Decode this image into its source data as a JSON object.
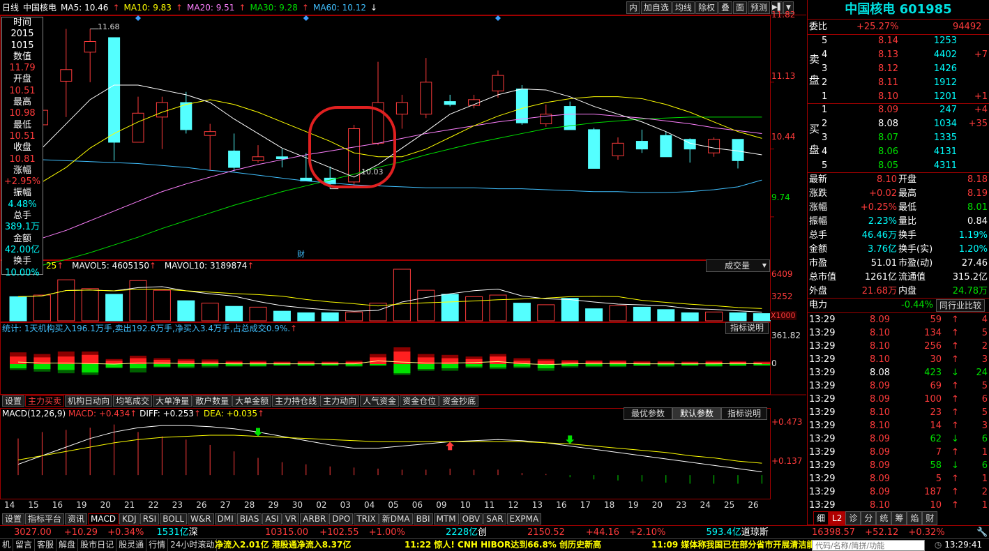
{
  "header": {
    "period": "日线",
    "stock": "中国核电",
    "ma5": "MA5: 10.46",
    "ma10": "MA10: 9.83",
    "ma20": "MA20: 9.51",
    "ma30": "MA30: 9.28",
    "ma60": "MA60: 10.12",
    "tools": [
      "内",
      "加自选",
      "均线",
      "除权",
      "叠",
      "面",
      "预测"
    ],
    "colors": {
      "ma5": "#ffffff",
      "ma10": "#ffff00",
      "ma20": "#ff80ff",
      "ma30": "#00e000",
      "ma60": "#40c0ff",
      "bull": "#ff3b3b",
      "bear": "#54ffff"
    }
  },
  "info": {
    "time_label": "时间",
    "year": "2015",
    "date": "1015",
    "value_label": "数值",
    "value": "11.79",
    "open_label": "开盘",
    "open": "10.51",
    "high_label": "最高",
    "high": "10.98",
    "low_label": "最低",
    "low": "10.51",
    "close_label": "收盘",
    "close": "10.81",
    "chg_label": "涨幅",
    "chg": "+2.95%",
    "amp_label": "振幅",
    "amp": "4.48%",
    "vol_label": "总手",
    "vol": "389.1万",
    "amt_label": "金额",
    "amt": "42.00亿",
    "turn_label": "换手",
    "turn": "10.00%"
  },
  "price_axis": [
    "11.82",
    "11.13",
    "10.44",
    "9.74"
  ],
  "price_annotations": {
    "high": "11.68",
    "low": "10.03",
    "event": "财"
  },
  "volume": {
    "header_prefix": "25",
    "mavol5": "MAVOL5: 4605150",
    "mavol10": "MAVOL10: 3189874",
    "dropdown": "成交量",
    "axis": [
      "6409",
      "3252",
      "X1000"
    ]
  },
  "flow": {
    "stats": "统计: 1天机构买入196.1万手,卖出192.6万手,净买入3.4万手,占总成交0.9%.",
    "button": "指标说明",
    "axis": [
      "361.82",
      "0"
    ],
    "tabs": [
      "设置",
      "主力买卖",
      "机构日动向",
      "均笔成交",
      "大单净量",
      "散户数量",
      "大单金额",
      "主力持仓线",
      "主力动向",
      "人气资金",
      "资金仓位",
      "资金抄底"
    ]
  },
  "macd": {
    "title": "MACD(12,26,9)",
    "macd": "MACD: +0.434",
    "diff": "DIFF: +0.253",
    "dea": "DEA: +0.035",
    "buttons": [
      "最优参数",
      "默认参数",
      "指标说明"
    ],
    "axis": [
      "+0.473",
      "+0.137"
    ]
  },
  "dates": [
    "14",
    "15",
    "16",
    "19",
    "20",
    "21",
    "22",
    "23",
    "26",
    "27",
    "28",
    "29",
    "30",
    "02",
    "03",
    "04",
    "05",
    "06",
    "09",
    "10",
    "11",
    "12",
    "13",
    "16",
    "17",
    "18",
    "19",
    "20",
    "23",
    "24",
    "25",
    "26"
  ],
  "indicator_tabs": [
    "设置",
    "指标平台",
    "资讯",
    "MACD",
    "KDJ",
    "RSI",
    "BOLL",
    "W&R",
    "DMI",
    "BIAS",
    "ASI",
    "VR",
    "ARBR",
    "DPO",
    "TRIX",
    "新DMA",
    "BBI",
    "MTM",
    "OBV",
    "SAR",
    "EXPMA"
  ],
  "quote": {
    "name": "中国核电",
    "code": "601985",
    "wb_label": "委比",
    "wb": "+25.27%",
    "wc": "94492",
    "sell_label": "卖盘",
    "buy_label": "买盘",
    "sell": [
      {
        "n": "5",
        "p": "8.14",
        "v": "1253",
        "d": ""
      },
      {
        "n": "4",
        "p": "8.13",
        "v": "4402",
        "d": "+7"
      },
      {
        "n": "3",
        "p": "8.12",
        "v": "1426",
        "d": ""
      },
      {
        "n": "2",
        "p": "8.11",
        "v": "1912",
        "d": ""
      },
      {
        "n": "1",
        "p": "8.10",
        "v": "1201",
        "d": "+1"
      }
    ],
    "buy": [
      {
        "n": "1",
        "p": "8.09",
        "v": "247",
        "d": "+4"
      },
      {
        "n": "2",
        "p": "8.08",
        "v": "1034",
        "d": "+35"
      },
      {
        "n": "3",
        "p": "8.07",
        "v": "1335",
        "d": ""
      },
      {
        "n": "4",
        "p": "8.06",
        "v": "4131",
        "d": ""
      },
      {
        "n": "5",
        "p": "8.05",
        "v": "4311",
        "d": ""
      }
    ],
    "stats": [
      {
        "l1": "最新",
        "v1": "8.10",
        "l2": "开盘",
        "v2": "8.18"
      },
      {
        "l1": "涨跌",
        "v1": "+0.02",
        "l2": "最高",
        "v2": "8.19"
      },
      {
        "l1": "涨幅",
        "v1": "+0.25%",
        "l2": "最低",
        "v2": "8.01"
      },
      {
        "l1": "振幅",
        "v1": "2.23%",
        "l2": "量比",
        "v2": "0.84"
      },
      {
        "l1": "总手",
        "v1": "46.46万",
        "l2": "换手",
        "v2": "1.19%"
      },
      {
        "l1": "金额",
        "v1": "3.76亿",
        "l2": "换手(实)",
        "v2": "1.20%"
      },
      {
        "l1": "市盈",
        "v1": "51.01",
        "l2": "市盈(动)",
        "v2": "27.46"
      },
      {
        "l1": "总市值",
        "v1": "1261亿",
        "l2": "流通值",
        "v2": "315.2亿"
      },
      {
        "l1": "外盘",
        "v1": "21.68万",
        "l2": "内盘",
        "v2": "24.78万"
      }
    ],
    "sector": "电力",
    "sector_chg": "-0.44%",
    "sector_btn": "同行业比较",
    "ticks": [
      {
        "t": "13:29",
        "p": "8.09",
        "v": "59",
        "dir": "up",
        "n": "4"
      },
      {
        "t": "13:29",
        "p": "8.10",
        "v": "134",
        "dir": "up",
        "n": "5"
      },
      {
        "t": "13:29",
        "p": "8.10",
        "v": "256",
        "dir": "up",
        "n": "2"
      },
      {
        "t": "13:29",
        "p": "8.10",
        "v": "30",
        "dir": "up",
        "n": "3"
      },
      {
        "t": "13:29",
        "p": "8.08",
        "v": "423",
        "dir": "down",
        "n": "24"
      },
      {
        "t": "13:29",
        "p": "8.09",
        "v": "69",
        "dir": "up",
        "n": "5"
      },
      {
        "t": "13:29",
        "p": "8.09",
        "v": "100",
        "dir": "up",
        "n": "6"
      },
      {
        "t": "13:29",
        "p": "8.10",
        "v": "23",
        "dir": "up",
        "n": "5"
      },
      {
        "t": "13:29",
        "p": "8.10",
        "v": "14",
        "dir": "up",
        "n": "3"
      },
      {
        "t": "13:29",
        "p": "8.09",
        "v": "62",
        "dir": "down",
        "n": "6"
      },
      {
        "t": "13:29",
        "p": "8.09",
        "v": "7",
        "dir": "up",
        "n": "1"
      },
      {
        "t": "13:29",
        "p": "8.09",
        "v": "58",
        "dir": "down",
        "n": "6"
      },
      {
        "t": "13:29",
        "p": "8.09",
        "v": "5",
        "dir": "up",
        "n": "1"
      },
      {
        "t": "13:29",
        "p": "8.09",
        "v": "187",
        "dir": "up",
        "n": "2"
      },
      {
        "t": "13:29",
        "p": "8.10",
        "v": "10",
        "dir": "up",
        "n": "1"
      }
    ],
    "tabs": [
      "细",
      "L2",
      "诊",
      "分",
      "统",
      "筹",
      "焰",
      "财"
    ]
  },
  "indices": [
    {
      "pts": "3027.00",
      "chg": "+10.29",
      "pct": "+0.34%",
      "amt": "1531亿",
      "name": "深"
    },
    {
      "pts": "10315.00",
      "chg": "+102.55",
      "pct": "+1.00%",
      "amt": "2228亿",
      "name": "创"
    },
    {
      "pts": "2150.52",
      "chg": "+44.16",
      "pct": "+2.10%",
      "amt": "593.4亿",
      "name": "道琼斯"
    },
    {
      "pts": "16398.57",
      "chg": "+52.12",
      "pct": "+0.32%",
      "amt": "",
      "name": ""
    }
  ],
  "ticker": {
    "menus": [
      "机",
      "留言",
      "客服",
      "解盘",
      "股市日记",
      "股灵通",
      "行情",
      "24小时滚动"
    ],
    "news1": "净流入2.01亿 港股通净流入8.37亿",
    "news2": "11:22 惊人! CNH HIBOR达到66.8% 创历史新高",
    "news3": "11:09 媒体称我国已在部分省市开展清洁能",
    "search_placeholder": "代码/名称/简拼/功能",
    "clock": "13:29:41"
  },
  "chart_data": {
    "type": "candlestick",
    "x": [
      "14",
      "15",
      "16",
      "19",
      "20",
      "21",
      "22",
      "23",
      "26",
      "27",
      "28",
      "29",
      "30",
      "02",
      "03",
      "04",
      "05",
      "06",
      "09",
      "10",
      "11",
      "12",
      "13",
      "16",
      "17",
      "18",
      "19",
      "20",
      "23",
      "24",
      "25",
      "26"
    ],
    "candles": [
      {
        "o": 10.76,
        "h": 10.83,
        "l": 10.44,
        "c": 10.69
      },
      {
        "o": 10.69,
        "h": 10.86,
        "l": 10.54,
        "c": 10.84
      },
      {
        "o": 11.14,
        "h": 11.68,
        "l": 10.77,
        "c": 11.26
      },
      {
        "o": 11.44,
        "h": 11.68,
        "l": 11.13,
        "c": 11.55
      },
      {
        "o": 11.59,
        "h": 11.59,
        "l": 10.32,
        "c": 10.51
      },
      {
        "o": 10.51,
        "h": 10.98,
        "l": 10.51,
        "c": 10.81
      },
      {
        "o": 10.77,
        "h": 10.98,
        "l": 10.44,
        "c": 10.92
      },
      {
        "o": 10.92,
        "h": 11.03,
        "l": 10.6,
        "c": 10.64
      },
      {
        "o": 10.58,
        "h": 10.7,
        "l": 10.22,
        "c": 10.62
      },
      {
        "o": 10.42,
        "h": 10.6,
        "l": 10.21,
        "c": 10.25
      },
      {
        "o": 10.32,
        "h": 10.48,
        "l": 10.3,
        "c": 10.36
      },
      {
        "o": 10.36,
        "h": 10.44,
        "l": 10.25,
        "c": 10.34
      },
      {
        "o": 10.14,
        "h": 10.4,
        "l": 10.12,
        "c": 10.11
      },
      {
        "o": 10.14,
        "h": 10.26,
        "l": 10.03,
        "c": 10.08
      },
      {
        "o": 10.1,
        "h": 10.69,
        "l": 10.04,
        "c": 10.65
      },
      {
        "o": 10.5,
        "h": 11.34,
        "l": 10.48,
        "c": 10.92
      },
      {
        "o": 10.8,
        "h": 11.0,
        "l": 10.65,
        "c": 10.92
      },
      {
        "o": 10.8,
        "h": 11.38,
        "l": 10.76,
        "c": 11.13
      },
      {
        "o": 10.93,
        "h": 11.0,
        "l": 10.88,
        "c": 10.9
      },
      {
        "o": 10.89,
        "h": 11.0,
        "l": 10.86,
        "c": 10.95
      },
      {
        "o": 11.04,
        "h": 11.25,
        "l": 10.97,
        "c": 11.2
      },
      {
        "o": 11.06,
        "h": 11.1,
        "l": 10.69,
        "c": 10.71
      },
      {
        "o": 10.7,
        "h": 10.9,
        "l": 10.67,
        "c": 10.8
      },
      {
        "o": 10.88,
        "h": 10.93,
        "l": 10.65,
        "c": 10.64
      },
      {
        "o": 10.64,
        "h": 10.66,
        "l": 10.24,
        "c": 10.24
      },
      {
        "o": 10.37,
        "h": 10.56,
        "l": 10.33,
        "c": 10.5
      },
      {
        "o": 10.52,
        "h": 10.64,
        "l": 10.4,
        "c": 10.44
      },
      {
        "o": 10.58,
        "h": 10.62,
        "l": 10.36,
        "c": 10.36
      },
      {
        "o": 10.54,
        "h": 10.55,
        "l": 10.3,
        "c": 10.44
      },
      {
        "o": 10.4,
        "h": 10.56,
        "l": 10.36,
        "c": 10.54
      },
      {
        "o": 10.54,
        "h": 10.52,
        "l": 10.24,
        "c": 10.32
      }
    ],
    "ma": {
      "ma5": [
        10.3,
        10.45,
        10.7,
        10.95,
        11.1,
        11.1,
        11.05,
        11.0,
        10.92,
        10.75,
        10.6,
        10.45,
        10.35,
        10.25,
        10.15,
        10.28,
        10.45,
        10.62,
        10.8,
        10.9,
        11.0,
        11.06,
        11.05,
        10.98,
        10.88,
        10.8,
        10.72,
        10.62,
        10.5,
        10.45,
        10.42,
        10.38
      ],
      "ma10": [
        10.0,
        10.1,
        10.25,
        10.45,
        10.6,
        10.72,
        10.82,
        10.9,
        10.95,
        10.9,
        10.82,
        10.72,
        10.62,
        10.52,
        10.4,
        10.36,
        10.36,
        10.44,
        10.56,
        10.68,
        10.78,
        10.86,
        10.92,
        10.96,
        10.98,
        10.98,
        10.96,
        10.9,
        10.82,
        10.72,
        10.62,
        10.55
      ],
      "ma20": [
        9.45,
        9.52,
        9.6,
        9.7,
        9.8,
        9.9,
        10.0,
        10.08,
        10.15,
        10.22,
        10.28,
        10.33,
        10.38,
        10.42,
        10.46,
        10.5,
        10.55,
        10.6,
        10.64,
        10.68,
        10.72,
        10.75,
        10.78,
        10.8,
        10.8,
        10.78,
        10.76,
        10.73,
        10.7,
        10.66,
        10.63,
        10.6
      ],
      "ma30": [
        9.18,
        9.24,
        9.3,
        9.37,
        9.45,
        9.53,
        9.62,
        9.7,
        9.78,
        9.86,
        9.93,
        10.0,
        10.06,
        10.12,
        10.18,
        10.25,
        10.31,
        10.38,
        10.44,
        10.5,
        10.55,
        10.6,
        10.65,
        10.68,
        10.71,
        10.73,
        10.75,
        10.76,
        10.77,
        10.77,
        10.77,
        10.77
      ],
      "ma60": [
        10.33,
        10.33,
        10.32,
        10.31,
        10.3,
        10.29,
        10.27,
        10.25,
        10.22,
        10.2,
        10.17,
        10.14,
        10.11,
        10.09,
        10.07,
        10.06,
        10.05,
        10.04,
        10.04,
        10.04,
        10.03,
        10.03,
        10.02,
        10.01,
        10.0,
        10.0,
        9.99,
        9.99,
        10.0,
        10.02,
        10.05,
        10.12
      ]
    },
    "ylim": [
      9.3,
      11.82
    ],
    "volume": [
      3000,
      3200,
      5100,
      4000,
      3300,
      5000,
      3800,
      2500,
      2200,
      1800,
      1700,
      1200,
      1000,
      1000,
      1100,
      2200,
      6409,
      3800,
      3300,
      3000,
      3200,
      2200,
      2000,
      2800,
      1500,
      1900,
      1700,
      1400,
      1000,
      1100,
      1000,
      900
    ],
    "vol_ylim": [
      0,
      6409
    ],
    "flow": [
      {
        "up": 140,
        "ud": 90,
        "dn": 70,
        "dd": 50
      },
      {
        "up": 120,
        "ud": 80,
        "dn": 90,
        "dd": 60
      },
      {
        "up": 150,
        "ud": 90,
        "dn": 110,
        "dd": 70
      },
      {
        "up": 150,
        "ud": 110,
        "dn": 130,
        "dd": 100
      },
      {
        "up": 60,
        "ud": 40,
        "dn": 50,
        "dd": 40
      },
      {
        "up": 100,
        "ud": 70,
        "dn": 100,
        "dd": 50
      },
      {
        "up": 70,
        "ud": 50,
        "dn": 40,
        "dd": 30
      },
      {
        "up": 60,
        "ud": 40,
        "dn": 50,
        "dd": 30
      },
      {
        "up": 55,
        "ud": 30,
        "dn": 40,
        "dd": 20
      },
      {
        "up": 40,
        "ud": 25,
        "dn": 30,
        "dd": 20
      },
      {
        "up": 40,
        "ud": 25,
        "dn": 30,
        "dd": 20
      },
      {
        "up": 30,
        "ud": 20,
        "dn": 20,
        "dd": 15
      },
      {
        "up": 35,
        "ud": 20,
        "dn": 25,
        "dd": 15
      },
      {
        "up": 30,
        "ud": 20,
        "dn": 20,
        "dd": 15
      },
      {
        "up": 40,
        "ud": 25,
        "dn": 30,
        "dd": 20
      },
      {
        "up": 120,
        "ud": 80,
        "dn": 20,
        "dd": 15
      },
      {
        "up": 200,
        "ud": 150,
        "dn": 130,
        "dd": 110
      },
      {
        "up": 120,
        "ud": 80,
        "dn": 80,
        "dd": 60
      },
      {
        "up": 110,
        "ud": 70,
        "dn": 80,
        "dd": 50
      },
      {
        "up": 90,
        "ud": 60,
        "dn": 50,
        "dd": 30
      },
      {
        "up": 120,
        "ud": 90,
        "dn": 60,
        "dd": 40
      },
      {
        "up": 70,
        "ud": 40,
        "dn": 50,
        "dd": 30
      },
      {
        "up": 60,
        "ud": 40,
        "dn": 80,
        "dd": 50
      },
      {
        "up": 50,
        "ud": 30,
        "dn": 40,
        "dd": 25
      },
      {
        "up": 45,
        "ud": 30,
        "dn": 35,
        "dd": 20
      },
      {
        "up": 45,
        "ud": 30,
        "dn": 35,
        "dd": 20
      },
      {
        "up": 35,
        "ud": 20,
        "dn": 25,
        "dd": 15
      },
      {
        "up": 35,
        "ud": 20,
        "dn": 30,
        "dd": 15
      },
      {
        "up": 30,
        "ud": 20,
        "dn": 20,
        "dd": 15
      },
      {
        "up": 40,
        "ud": 25,
        "dn": 30,
        "dd": 20
      },
      {
        "up": 35,
        "ud": 25,
        "dn": 25,
        "dd": 15
      },
      {
        "up": 30,
        "ud": 20,
        "dn": 20,
        "dd": 15
      }
    ],
    "flow_ylim": [
      -361.82,
      361.82
    ],
    "macd_bars": [
      0.34,
      0.4,
      0.42,
      0.44,
      0.47,
      0.4,
      0.36,
      0.33,
      0.28,
      0.22,
      0.16,
      0.12,
      0.1,
      0.08,
      0.07,
      0.06,
      0.05,
      0.05,
      0.06,
      0.05,
      0.05,
      0.02,
      0.01,
      -0.02,
      -0.04,
      -0.05,
      -0.06,
      -0.07,
      -0.08,
      -0.08,
      -0.08,
      -0.08
    ],
    "diff": [
      0.1,
      0.18,
      0.26,
      0.34,
      0.4,
      0.44,
      0.46,
      0.46,
      0.45,
      0.43,
      0.4,
      0.36,
      0.32,
      0.28,
      0.25,
      0.25,
      0.27,
      0.29,
      0.31,
      0.32,
      0.33,
      0.32,
      0.3,
      0.27,
      0.24,
      0.21,
      0.18,
      0.15,
      0.12,
      0.09,
      0.06,
      0.03
    ],
    "dea": [
      0.14,
      0.18,
      0.22,
      0.26,
      0.3,
      0.33,
      0.35,
      0.36,
      0.37,
      0.37,
      0.36,
      0.35,
      0.34,
      0.33,
      0.32,
      0.31,
      0.31,
      0.31,
      0.31,
      0.31,
      0.31,
      0.31,
      0.3,
      0.29,
      0.27,
      0.25,
      0.23,
      0.21,
      0.18,
      0.16,
      0.13,
      0.11
    ],
    "macd_ylim": [
      -0.2,
      0.5
    ]
  }
}
